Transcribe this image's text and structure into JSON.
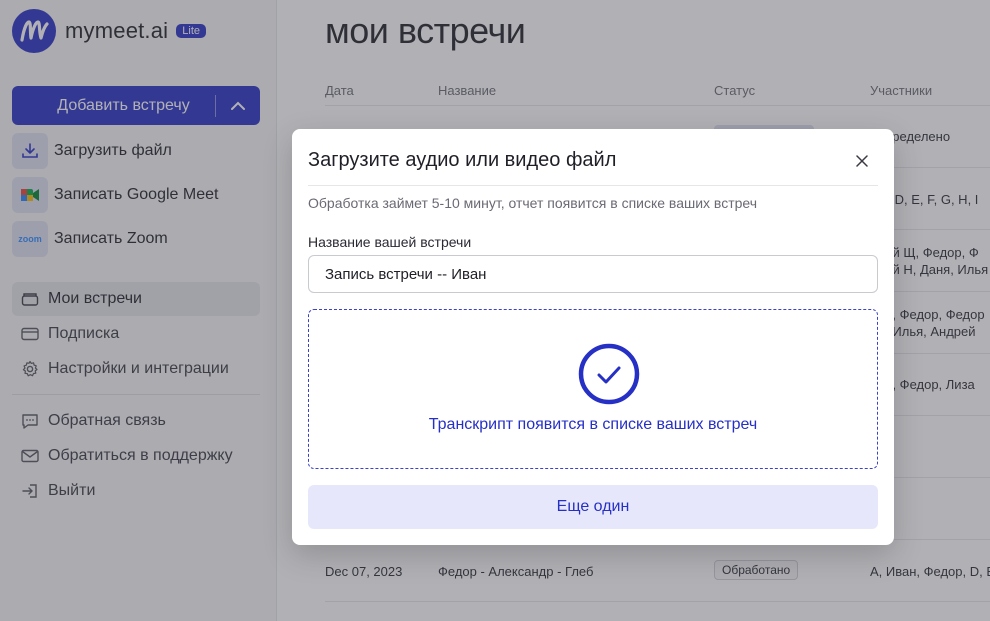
{
  "brand": {
    "name": "mymeet.ai",
    "badge": "Lite"
  },
  "sidebar": {
    "add_button": "Добавить встречу",
    "sub_items": [
      {
        "label": "Загрузить файл",
        "icon": "upload-icon"
      },
      {
        "label": "Записать Google Meet",
        "icon": "google-meet-icon"
      },
      {
        "label": "Записать Zoom",
        "icon": "zoom-icon",
        "icon_text": "zoom"
      }
    ],
    "nav": [
      {
        "label": "Мои встречи",
        "icon": "folder-icon",
        "active": true
      },
      {
        "label": "Подписка",
        "icon": "card-icon"
      },
      {
        "label": "Настройки и интеграции",
        "icon": "gear-icon"
      }
    ],
    "nav2": [
      {
        "label": "Обратная связь",
        "icon": "chat-icon"
      },
      {
        "label": "Обратиться в поддержку",
        "icon": "mail-icon"
      },
      {
        "label": "Выйти",
        "icon": "logout-icon"
      }
    ]
  },
  "main": {
    "title": "мои встречи",
    "columns": [
      "Дата",
      "Название",
      "Статус",
      "Участники"
    ],
    "rows": [
      {
        "participants": "определено"
      },
      {
        "participants": "C, D, E, F, G, H, I"
      },
      {
        "participants": "рей Щ, Федор, Ф",
        "participants2": "рей Н, Даня, Илья"
      },
      {
        "participants": "ан, Федор, Федор",
        "participants2": "н, Илья, Андрей"
      },
      {
        "participants": "ор, Федор, Лиза"
      },
      {
        "date": "Dec 07, 2023",
        "name": "Федор - Александр - Глеб",
        "status": "Обработано",
        "participants": "A, Иван, Федор, D, E"
      }
    ]
  },
  "modal": {
    "title": "Загрузите аудио или видео файл",
    "subtitle": "Обработка займет 5-10 минут, отчет появится в списке ваших встреч",
    "field_label": "Название вашей встречи",
    "field_value": "Запись встречи -- Иван",
    "drop_text": "Транскрипт появится в списке ваших встреч",
    "again_button": "Еще один"
  },
  "colors": {
    "accent": "#2630c4",
    "accent_light": "#e6e7fb"
  }
}
